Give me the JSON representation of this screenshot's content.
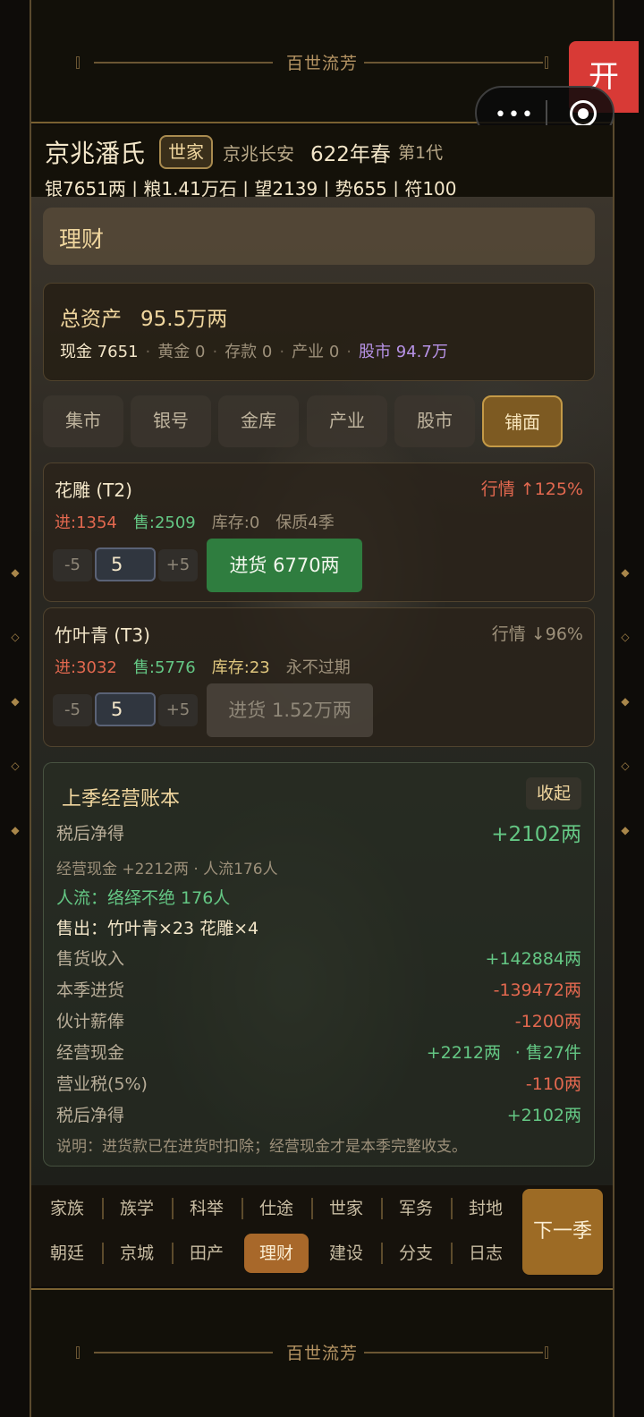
{
  "banner": {
    "title": "百世流芳"
  },
  "corner_button": {
    "label": "开"
  },
  "capsule": {
    "menu_icon": "more-dots-icon",
    "close_icon": "target-icon"
  },
  "header": {
    "family_name": "京兆潘氏",
    "rank_badge": "世家",
    "location": "京兆长安",
    "date": "622年春",
    "generation": "第1代",
    "stats": "银7651两 | 粮1.41万石 | 望2139 | 势655 | 符100"
  },
  "section": {
    "title": "理财"
  },
  "assets": {
    "total_label": "总资产",
    "total_value": "95.5万两",
    "cash": "现金 7651",
    "gold": "黄金 0",
    "deposit": "存款 0",
    "industry": "产业 0",
    "stocks": "股市 94.7万",
    "separator": "·"
  },
  "tabs": [
    {
      "label": "集市"
    },
    {
      "label": "银号"
    },
    {
      "label": "金库"
    },
    {
      "label": "产业"
    },
    {
      "label": "股市"
    },
    {
      "label": "铺面"
    }
  ],
  "items": [
    {
      "name": "花雕 (T2)",
      "trend": "行情 ↑125%",
      "buy_price": "进:1354",
      "sell_price": "售:2509",
      "stock": "库存:0",
      "shelf": "保质4季",
      "minus": "-5",
      "qty": "5",
      "plus": "+5",
      "buy_label": "进货 6770两"
    },
    {
      "name": "竹叶青 (T3)",
      "trend": "行情 ↓96%",
      "buy_price": "进:3032",
      "sell_price": "售:5776",
      "stock": "库存:23",
      "shelf": "永不过期",
      "minus": "-5",
      "qty": "5",
      "plus": "+5",
      "buy_label": "进货 1.52万两"
    }
  ],
  "ledger": {
    "title": "上季经营账本",
    "collapse": "收起",
    "net_label": "税后净得",
    "net_value": "+2102两",
    "summary": "经营现金 +2212两 · 人流176人",
    "traffic": "人流：络绎不绝 176人",
    "sold": "售出：竹叶青×23 花雕×4",
    "rows": [
      {
        "label": "售货收入",
        "value": "+142884两"
      },
      {
        "label": "本季进货",
        "value": "-139472两"
      },
      {
        "label": "伙计薪俸",
        "value": "-1200两"
      },
      {
        "label": "经营现金",
        "value": "+2212两",
        "extra": "· 售27件"
      },
      {
        "label": "营业税(5%)",
        "value": "-110两"
      },
      {
        "label": "税后净得",
        "value": "+2102两"
      }
    ],
    "note": "说明：进货款已在进货时扣除；经营现金才是本季完整收支。"
  },
  "nav": {
    "row1": [
      "家族",
      "族学",
      "科举",
      "仕途",
      "世家",
      "军务",
      "封地"
    ],
    "row2": [
      "朝廷",
      "京城",
      "田产",
      "理财",
      "建设",
      "分支",
      "日志"
    ],
    "next": "下一季"
  },
  "colors": {
    "gain": "#64c784",
    "loss": "#e2684f",
    "accent": "#f0d69e",
    "stock": "#b792e6",
    "buy_button": "#2f7d3f"
  }
}
